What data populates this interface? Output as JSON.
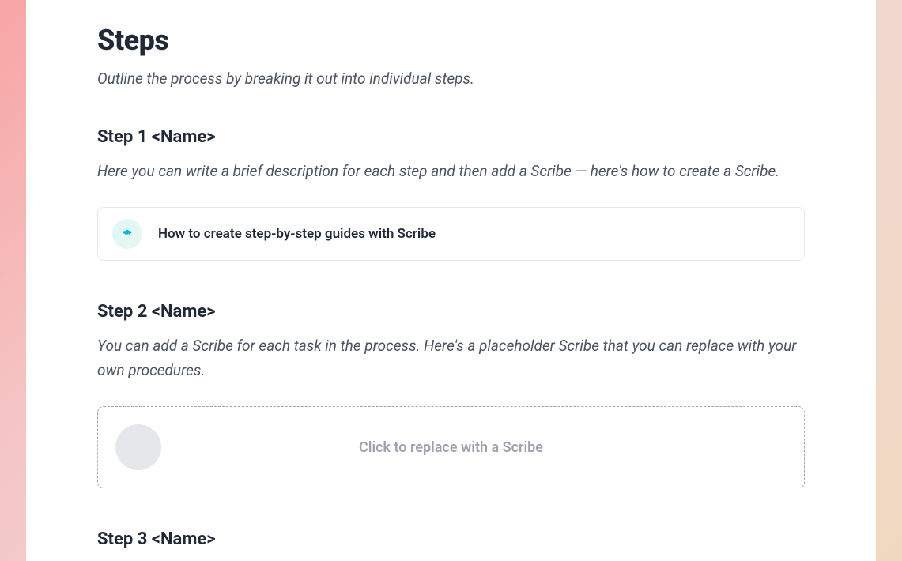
{
  "steps": {
    "heading": "Steps",
    "subtitle": "Outline the process by breaking it out into individual steps."
  },
  "step1": {
    "heading": "Step 1 <Name>",
    "description": "Here you can write a brief description for each step and then add a Scribe  —  here's how to create a Scribe."
  },
  "scribe_card": {
    "title": "How to create step-by-step guides with Scribe"
  },
  "step2": {
    "heading": "Step 2 <Name>",
    "description": "You can add a Scribe for each task in the process. Here's a placeholder Scribe that you can replace with your own procedures."
  },
  "placeholder": {
    "text": "Click to replace with a Scribe"
  },
  "step3": {
    "heading": "Step 3 <Name>"
  }
}
